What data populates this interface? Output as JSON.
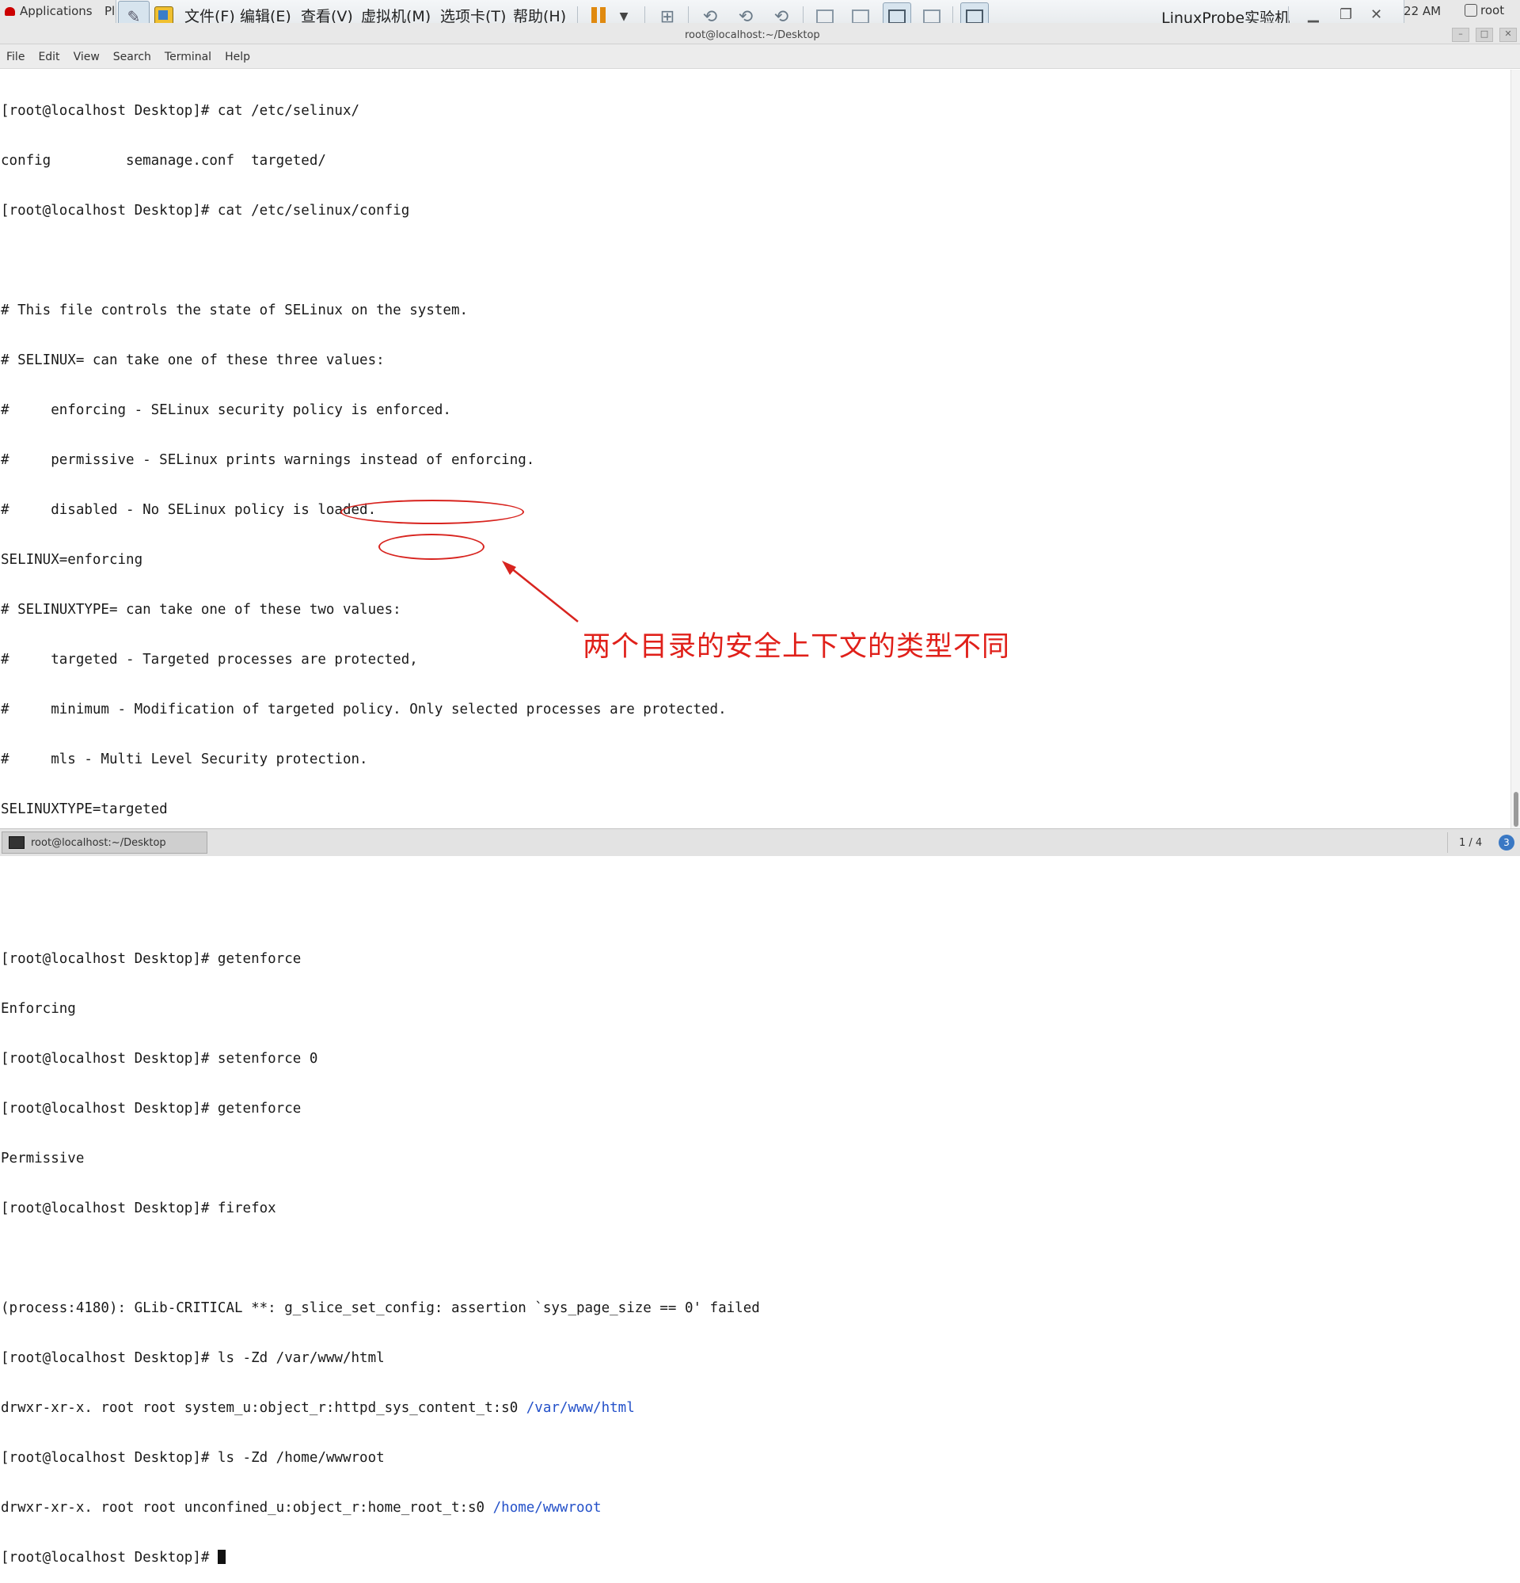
{
  "gnome_topbar": {
    "applications_label": "Applications",
    "places_label": "Pl",
    "clock": ":22 AM",
    "user": "root"
  },
  "vmware_toolbar": {
    "menus": [
      "文件(F)",
      "编辑(E)",
      "查看(V)",
      "虚拟机(M)",
      "选项卡(T)",
      "帮助(H)"
    ],
    "vm_title": "LinuxProbe实验机"
  },
  "terminal": {
    "title": "root@localhost:~/Desktop",
    "menu": [
      "File",
      "Edit",
      "View",
      "Search",
      "Terminal",
      "Help"
    ],
    "lines": [
      "[root@localhost Desktop]# cat /etc/selinux/",
      "config         semanage.conf  targeted/",
      "[root@localhost Desktop]# cat /etc/selinux/config",
      "",
      "# This file controls the state of SELinux on the system.",
      "# SELINUX= can take one of these three values:",
      "#     enforcing - SELinux security policy is enforced.",
      "#     permissive - SELinux prints warnings instead of enforcing.",
      "#     disabled - No SELinux policy is loaded.",
      "SELINUX=enforcing",
      "# SELINUXTYPE= can take one of these two values:",
      "#     targeted - Targeted processes are protected,",
      "#     minimum - Modification of targeted policy. Only selected processes are protected.",
      "#     mls - Multi Level Security protection.",
      "SELINUXTYPE=targeted",
      "",
      "",
      "[root@localhost Desktop]# getenforce",
      "Enforcing",
      "[root@localhost Desktop]# setenforce 0",
      "[root@localhost Desktop]# getenforce",
      "Permissive",
      "[root@localhost Desktop]# firefox",
      "",
      "(process:4180): GLib-CRITICAL **: g_slice_set_config: assertion `sys_page_size == 0' failed",
      "[root@localhost Desktop]# ls -Zd /var/www/html"
    ],
    "ls1_prefix": "drwxr-xr-x. root root system_u:object_r:httpd_sys_content_t:s0 ",
    "ls1_path": "/var/www/html",
    "cmd2": "[root@localhost Desktop]# ls -Zd /home/wwwroot",
    "ls2_prefix": "drwxr-xr-x. root root unconfined_u:object_r:home_root_t:s0 ",
    "ls2_path": "/home/wwwroot",
    "prompt": "[root@localhost Desktop]# "
  },
  "annotation": {
    "text": "两个目录的安全上下文的类型不同",
    "color": "#e0201a"
  },
  "taskbar": {
    "task_label": "root@localhost:~/Desktop",
    "pager": "1 / 4",
    "notification_count": "3"
  }
}
